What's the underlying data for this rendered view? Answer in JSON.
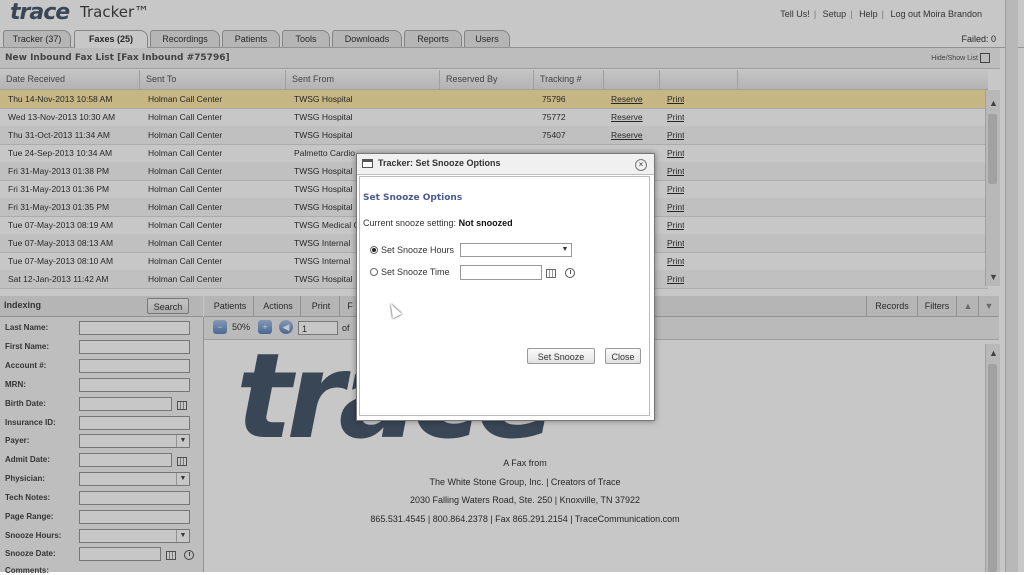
{
  "app": {
    "logo": "trace",
    "title": "Tracker™"
  },
  "top_links": [
    "Tell Us!",
    "Setup",
    "Help",
    "Log out Moira Brandon"
  ],
  "tabs": [
    {
      "label": "Tracker (37)"
    },
    {
      "label": "Faxes (25)"
    },
    {
      "label": "Recordings"
    },
    {
      "label": "Patients"
    },
    {
      "label": "Tools"
    },
    {
      "label": "Downloads"
    },
    {
      "label": "Reports"
    },
    {
      "label": "Users"
    }
  ],
  "failed": "Failed: 0",
  "list": {
    "title": "New Inbound Fax List [Fax Inbound #75796]",
    "hide_show": "Hide/Show List",
    "columns": [
      "Date Received",
      "Sent To",
      "Sent From",
      "Reserved By",
      "Tracking #"
    ],
    "rows": [
      {
        "date": "Thu 14-Nov-2013 10:58 AM",
        "to": "Holman Call Center",
        "from": "TWSG Hospital",
        "res": "",
        "track": "75796",
        "a1": "Reserve",
        "a2": "Print"
      },
      {
        "date": "Wed 13-Nov-2013 10:30 AM",
        "to": "Holman Call Center",
        "from": "TWSG Hospital",
        "res": "",
        "track": "75772",
        "a1": "Reserve",
        "a2": "Print"
      },
      {
        "date": "Thu 31-Oct-2013 11:34 AM",
        "to": "Holman Call Center",
        "from": "TWSG Hospital",
        "res": "",
        "track": "75407",
        "a1": "Reserve",
        "a2": "Print"
      },
      {
        "date": "Tue 24-Sep-2013 10:34 AM",
        "to": "Holman Call Center",
        "from": "Palmetto Cardio",
        "res": "",
        "track": "",
        "a1": "",
        "a2": "Print"
      },
      {
        "date": "Fri 31-May-2013 01:38 PM",
        "to": "Holman Call Center",
        "from": "TWSG Hospital",
        "res": "",
        "track": "",
        "a1": "",
        "a2": "Print"
      },
      {
        "date": "Fri 31-May-2013 01:36 PM",
        "to": "Holman Call Center",
        "from": "TWSG Hospital",
        "res": "",
        "track": "",
        "a1": "",
        "a2": "Print"
      },
      {
        "date": "Fri 31-May-2013 01:35 PM",
        "to": "Holman Call Center",
        "from": "TWSG Hospital",
        "res": "",
        "track": "",
        "a1": "",
        "a2": "Print"
      },
      {
        "date": "Tue 07-May-2013 08:19 AM",
        "to": "Holman Call Center",
        "from": "TWSG Medical C",
        "res": "",
        "track": "",
        "a1": "",
        "a2": "Print"
      },
      {
        "date": "Tue 07-May-2013 08:13 AM",
        "to": "Holman Call Center",
        "from": "TWSG Internal",
        "res": "",
        "track": "",
        "a1": "",
        "a2": "Print"
      },
      {
        "date": "Tue 07-May-2013 08:10 AM",
        "to": "Holman Call Center",
        "from": "TWSG Internal",
        "res": "",
        "track": "",
        "a1": "",
        "a2": "Print"
      },
      {
        "date": "Sat 12-Jan-2013 11:42 AM",
        "to": "Holman Call Center",
        "from": "TWSG Hospital",
        "res": "",
        "track": "",
        "a1": "",
        "a2": "Print"
      }
    ]
  },
  "indexing": {
    "title": "Indexing",
    "search": "Search",
    "fields": [
      "Last Name:",
      "First Name:",
      "Account #:",
      "MRN:",
      "Birth Date:",
      "Insurance ID:",
      "Payer:",
      "Admit Date:",
      "Physician:",
      "Tech Notes:",
      "Page Range:",
      "Snooze Hours:",
      "Snooze Date:",
      "Comments:"
    ]
  },
  "viewer": {
    "tabs": [
      "Patients",
      "Actions",
      "Print",
      "F"
    ],
    "right_tabs": [
      "Records",
      "Filters"
    ],
    "zoom": "50%",
    "page": "1",
    "of": "of"
  },
  "fax": {
    "logo": "trace",
    "lines": [
      "A Fax from",
      "The White Stone Group, Inc. | Creators of Trace",
      "2030 Falling Waters Road, Ste. 250 | Knoxville, TN 37922",
      "865.531.4545 | 800.864.2378 | Fax 865.291.2154 | TraceCommunication.com"
    ]
  },
  "dialog": {
    "title": "Tracker: Set Snooze Options",
    "heading": "Set Snooze Options",
    "current_label": "Current snooze setting:",
    "current_value": "Not snoozed",
    "opt_hours": "Set Snooze Hours",
    "opt_time": "Set Snooze Time",
    "btn_set": "Set Snooze",
    "btn_close": "Close"
  }
}
